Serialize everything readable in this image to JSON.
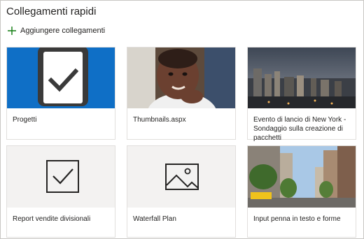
{
  "header": {
    "title": "Collegamenti rapidi",
    "add_link_label": "Aggiungere collegamenti"
  },
  "colors": {
    "accent_blue": "#0f6fc6",
    "plus_green": "#107c10",
    "tile_gray": "#f3f2f1"
  },
  "cards": [
    {
      "label": "Progetti",
      "icon": "clipboard-check-icon"
    },
    {
      "label": "Thumbnails.aspx",
      "icon": "child-photo"
    },
    {
      "label": "Evento di lancio di New York - Sondaggio sulla creazione di pacchetti",
      "icon": "city-skyline-photo"
    },
    {
      "label": "Report vendite divisionali",
      "icon": "checkbox-icon"
    },
    {
      "label": "Waterfall Plan",
      "icon": "image-icon"
    },
    {
      "label": "Input penna in testo e forme",
      "icon": "city-street-photo"
    }
  ]
}
